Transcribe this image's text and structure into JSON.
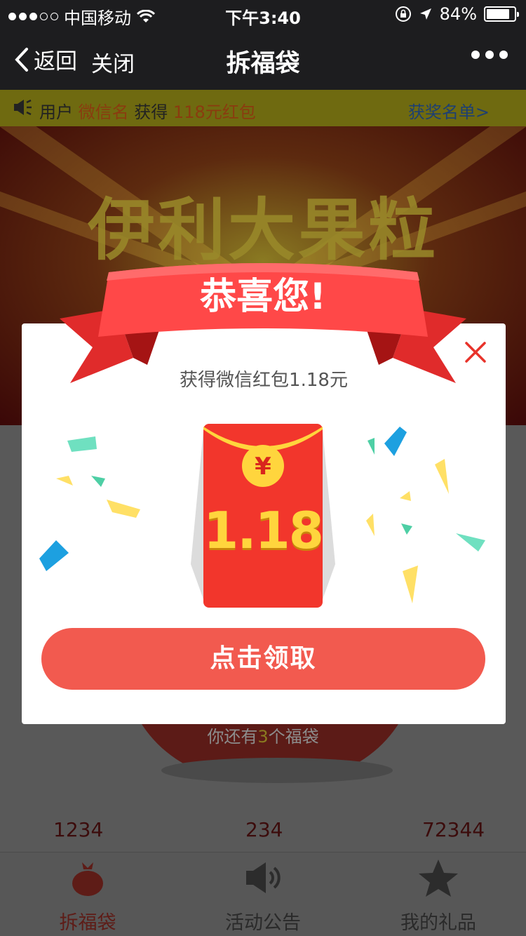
{
  "status_bar": {
    "carrier": "中国移动",
    "time": "下午3:40",
    "battery": "84%",
    "battery_level": 0.84
  },
  "nav": {
    "back_label": "返回",
    "close_label": "关闭",
    "title": "拆福袋"
  },
  "ticker": {
    "prefix": "用户",
    "user": "微信名",
    "verb": "获得",
    "prize": "118元红包",
    "winners_link": "获奖名单>"
  },
  "poster": {
    "headline": "伊利大果粒"
  },
  "modal": {
    "ribbon_text": "恭喜您!",
    "subtitle": "获得微信红包1.18元",
    "currency_symbol": "¥",
    "amount": "1.18",
    "cta_label": "点击领取"
  },
  "background": {
    "remaining_prefix": "你还有",
    "remaining_count": "3",
    "remaining_suffix": "个福袋",
    "counters": [
      "1234",
      "234",
      "72344"
    ]
  },
  "tabbar": {
    "tabs": [
      {
        "label": "拆福袋",
        "icon": "lucky-bag-icon",
        "active": true
      },
      {
        "label": "活动公告",
        "icon": "speaker-icon",
        "active": false
      },
      {
        "label": "我的礼品",
        "icon": "star-icon",
        "active": false
      }
    ]
  },
  "colors": {
    "accent": "#f25a4f",
    "ribbon": "#ff4a4a",
    "envelope": "#f2362c",
    "gold": "#ffd53d"
  }
}
